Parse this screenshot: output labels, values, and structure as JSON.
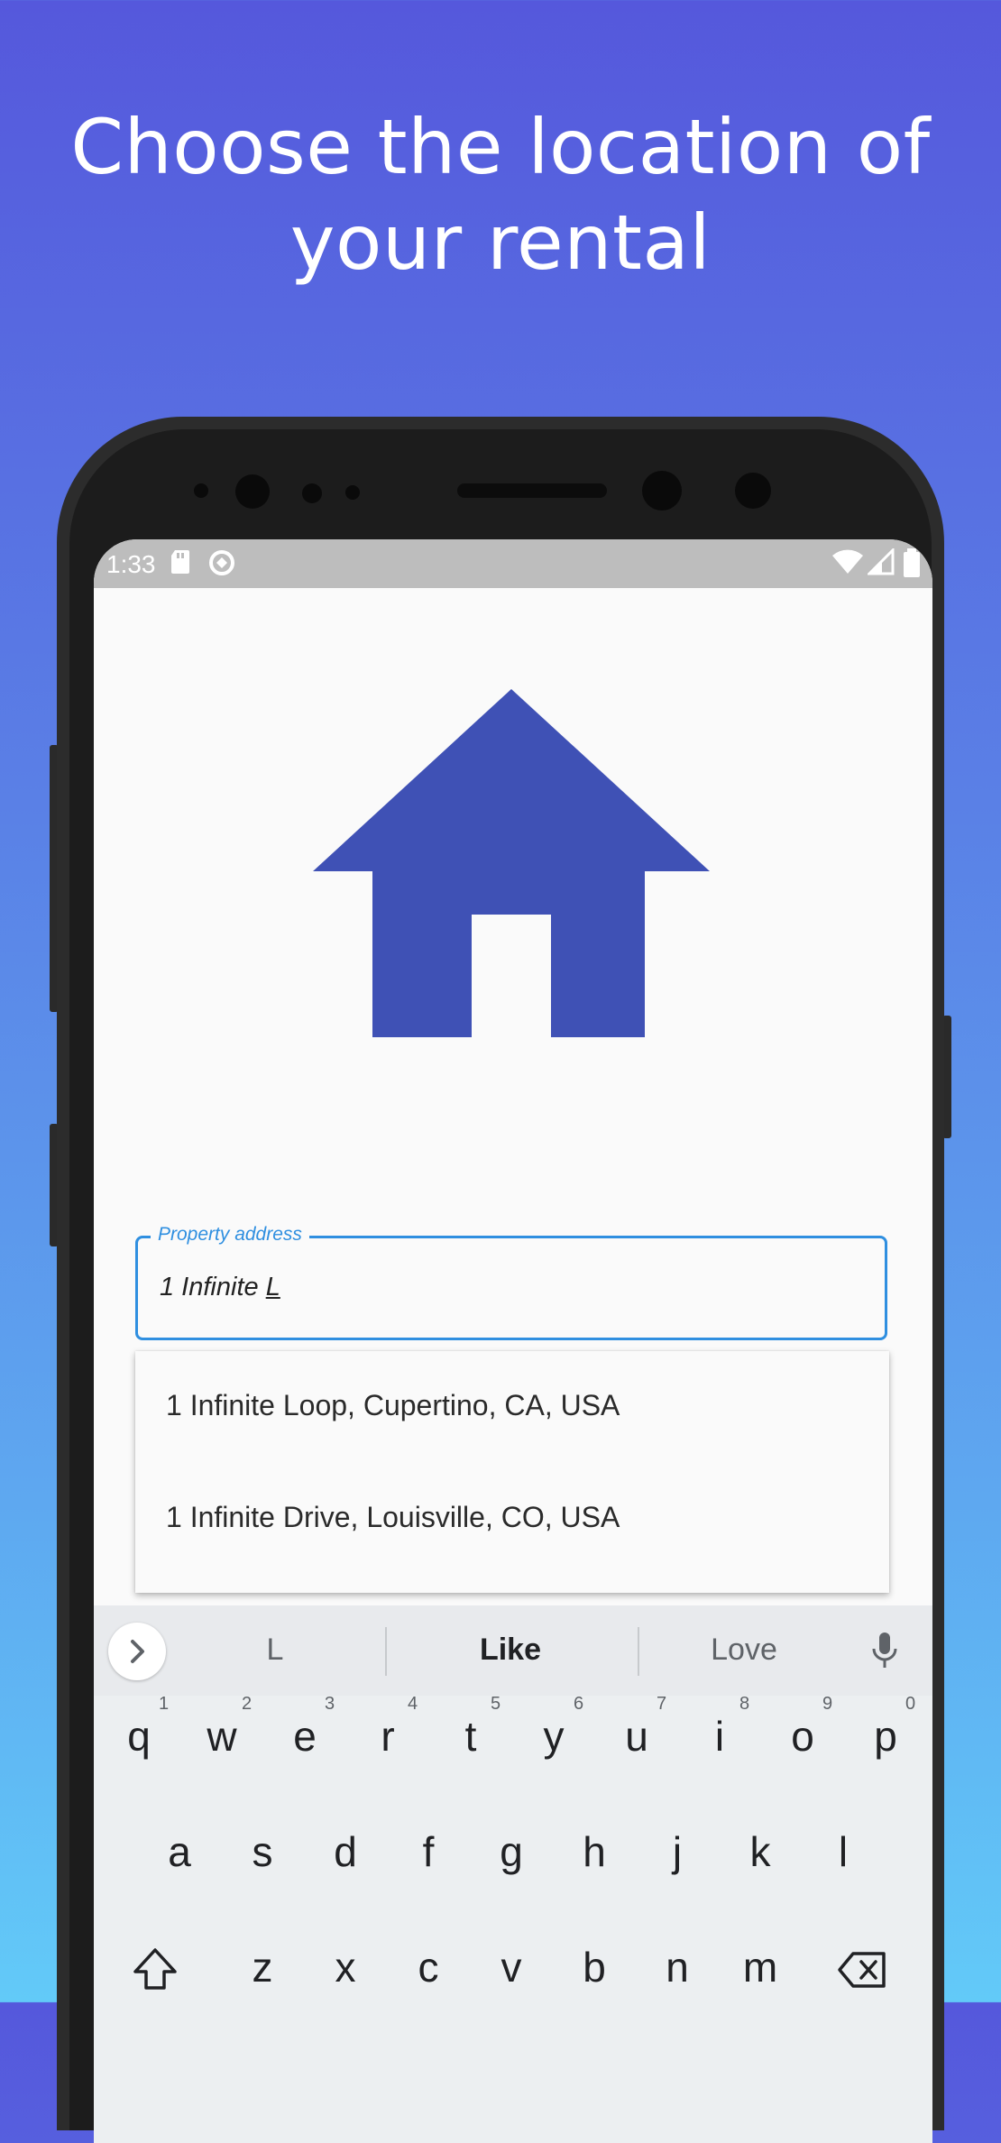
{
  "headline": {
    "line1": "Choose the location of",
    "line2": "your rental"
  },
  "status_bar": {
    "time": "1:33"
  },
  "brand_color": "#3f51b5",
  "accent_color": "#2f8fe0",
  "address_field": {
    "label": "Property address",
    "value_prefix": "1 Infinite ",
    "value_composing": "L"
  },
  "suggestions_dropdown": [
    "1 Infinite Loop, Cupertino, CA, USA",
    "1 Infinite Drive, Louisville, CO, USA"
  ],
  "keyboard": {
    "word_suggestions": [
      "L",
      "Like",
      "Love"
    ],
    "row1": [
      "q",
      "w",
      "e",
      "r",
      "t",
      "y",
      "u",
      "i",
      "o",
      "p"
    ],
    "row1_hints": [
      "1",
      "2",
      "3",
      "4",
      "5",
      "6",
      "7",
      "8",
      "9",
      "0"
    ],
    "row2": [
      "a",
      "s",
      "d",
      "f",
      "g",
      "h",
      "j",
      "k",
      "l"
    ],
    "row3": [
      "z",
      "x",
      "c",
      "v",
      "b",
      "n",
      "m"
    ]
  }
}
